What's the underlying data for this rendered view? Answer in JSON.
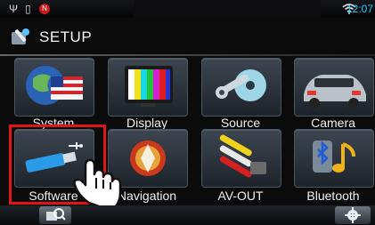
{
  "status_bar": {
    "time": "12:07",
    "icons": [
      "usb-icon",
      "phone-icon",
      "n-badge-icon",
      "wifi-icon"
    ]
  },
  "header": {
    "title": "SETUP"
  },
  "menu": {
    "items": [
      {
        "label": "System",
        "icon": "globe-flag-icon"
      },
      {
        "label": "Display",
        "icon": "tv-colorbars-icon"
      },
      {
        "label": "Source",
        "icon": "wrench-disc-icon"
      },
      {
        "label": "Camera",
        "icon": "car-rear-icon"
      },
      {
        "label": "Software",
        "icon": "usb-stick-icon"
      },
      {
        "label": "Navigation",
        "icon": "navigation-compass-icon"
      },
      {
        "label": "AV-OUT",
        "icon": "av-cables-icon"
      },
      {
        "label": "Bluetooth",
        "icon": "bluetooth-music-icon"
      }
    ]
  },
  "highlight": {
    "target": "Software"
  },
  "colors": {
    "time_accent": "#26c8ff",
    "highlight": "#e01616"
  }
}
